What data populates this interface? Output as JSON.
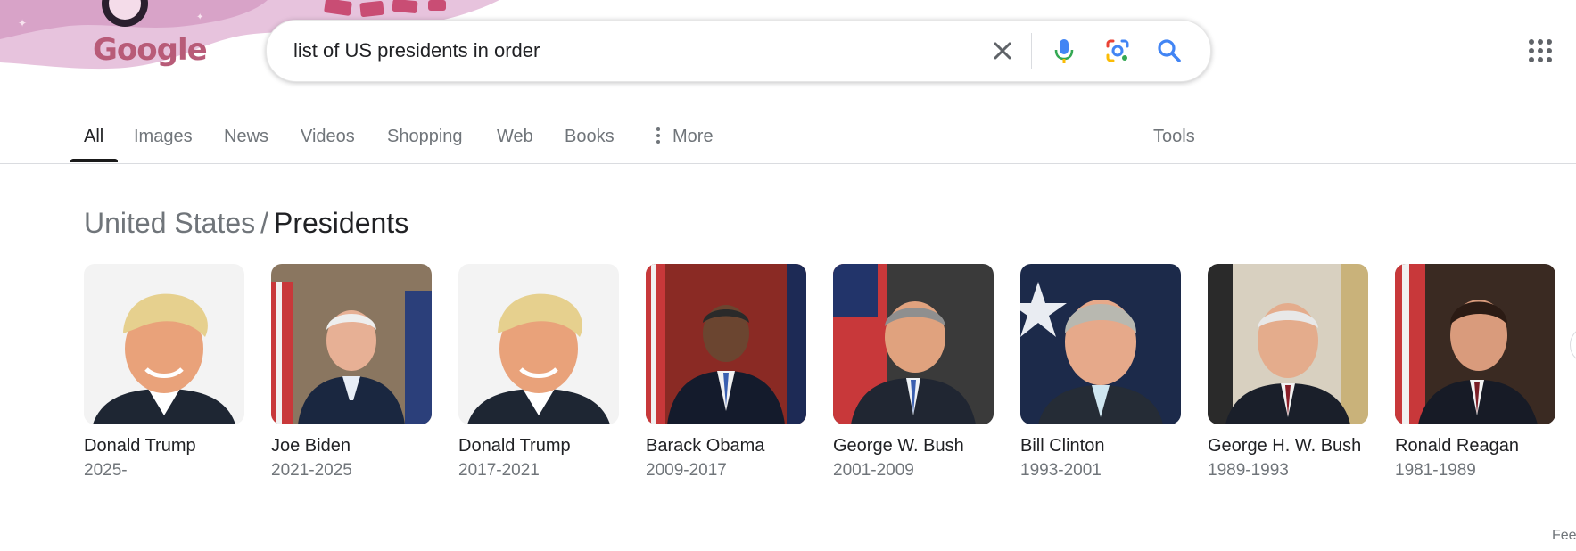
{
  "search": {
    "query": "list of US presidents in order",
    "logo_text": "Google"
  },
  "tabs": [
    {
      "label": "All",
      "active": true
    },
    {
      "label": "Images"
    },
    {
      "label": "News"
    },
    {
      "label": "Videos"
    },
    {
      "label": "Shopping"
    },
    {
      "label": "Web"
    },
    {
      "label": "Books"
    },
    {
      "label": "More"
    },
    {
      "label": "Tools"
    }
  ],
  "heading": {
    "parent": "United States",
    "separator": "/",
    "current": "Presidents"
  },
  "presidents": [
    {
      "name": "Donald Trump",
      "years": "2025-"
    },
    {
      "name": "Joe Biden",
      "years": "2021-2025"
    },
    {
      "name": "Donald Trump",
      "years": "2017-2021"
    },
    {
      "name": "Barack Obama",
      "years": "2009-2017"
    },
    {
      "name": "George W. Bush",
      "years": "2001-2009"
    },
    {
      "name": "Bill Clinton",
      "years": "1993-2001"
    },
    {
      "name": "George H. W. Bush",
      "years": "1989-1993"
    },
    {
      "name": "Ronald Reagan",
      "years": "1981-1989"
    }
  ],
  "feedback": "Fee",
  "icons": [
    "clear-icon",
    "microphone-icon",
    "camera-lens-icon",
    "search-icon",
    "apps-grid-icon",
    "more-vertical-icon",
    "chevron-right-icon"
  ],
  "colors": {
    "accent": "#4285f4",
    "doodle": "#d8a3c8",
    "text_muted": "#70757a"
  }
}
